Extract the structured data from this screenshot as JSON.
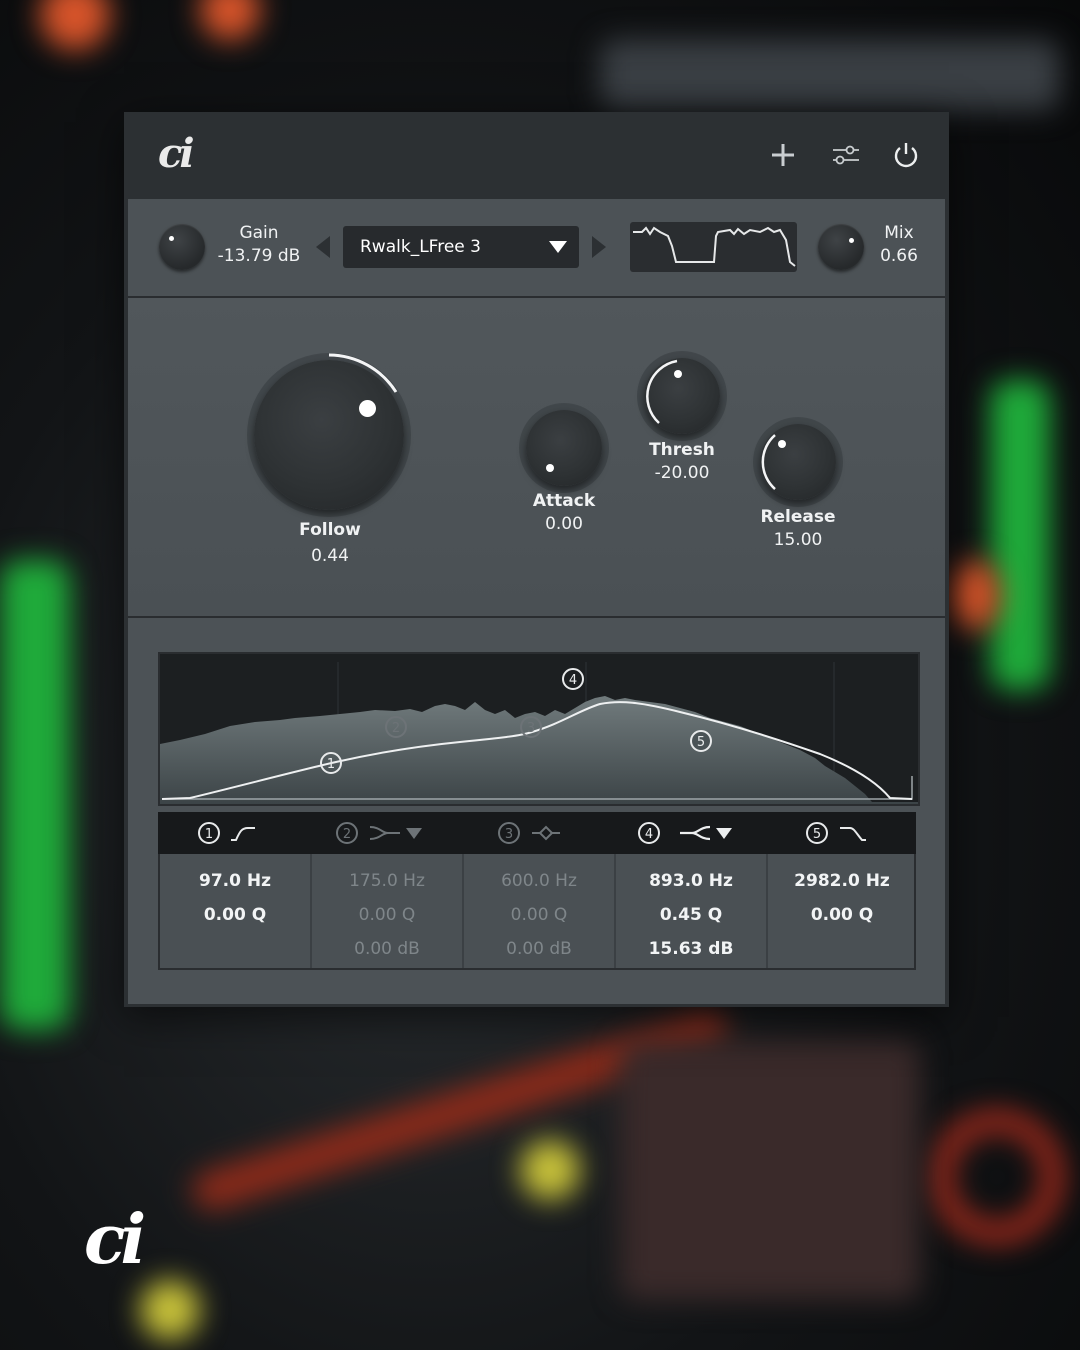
{
  "header": {
    "logo_text": "ci",
    "add_icon": "plus-icon",
    "settings_icon": "sliders-icon",
    "power_icon": "power-icon"
  },
  "topbar": {
    "gain_label": "Gain",
    "gain_value": "-13.79 dB",
    "preset_name": "Rwalk_LFree 3",
    "mix_label": "Mix",
    "mix_value": "0.66"
  },
  "knobs": {
    "follow": {
      "label": "Follow",
      "value": "0.44"
    },
    "attack": {
      "label": "Attack",
      "value": "0.00"
    },
    "thresh": {
      "label": "Thresh",
      "value": "-20.00"
    },
    "release": {
      "label": "Release",
      "value": "15.00"
    }
  },
  "eq": {
    "nodes": [
      "1",
      "2",
      "3",
      "4",
      "5"
    ],
    "bands": [
      {
        "num": "1",
        "type_icon": "high-pass-icon",
        "freq": "97.0 Hz",
        "q": "0.00 Q",
        "gain": "",
        "active": true
      },
      {
        "num": "2",
        "type_icon": "low-shelf-icon",
        "freq": "175.0 Hz",
        "q": "0.00 Q",
        "gain": "0.00 dB",
        "active": false
      },
      {
        "num": "3",
        "type_icon": "bell-icon",
        "freq": "600.0 Hz",
        "q": "0.00 Q",
        "gain": "0.00 dB",
        "active": false
      },
      {
        "num": "4",
        "type_icon": "high-shelf-icon",
        "freq": "893.0 Hz",
        "q": "0.45 Q",
        "gain": "15.63 dB",
        "active": true
      },
      {
        "num": "5",
        "type_icon": "low-pass-icon",
        "freq": "2982.0 Hz",
        "q": "0.00 Q",
        "gain": "",
        "active": true
      }
    ]
  },
  "watermark_text": "ci",
  "colors": {
    "panel": "#4c5256",
    "dark": "#2c3033",
    "accent": "#ffffff"
  }
}
